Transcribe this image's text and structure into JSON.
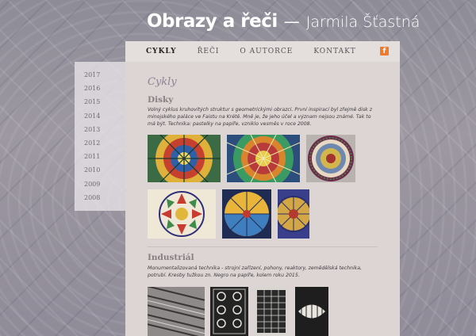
{
  "header": {
    "site_title": "Obrazy a řeči",
    "separator": "—",
    "author": "Jarmila Šťastná"
  },
  "nav": {
    "items": [
      "CYKLY",
      "ŘEČI",
      "O AUTORCE",
      "KONTAKT"
    ],
    "social_icon": "facebook-icon"
  },
  "sidebar": {
    "years": [
      "2017",
      "2016",
      "2015",
      "2014",
      "2013",
      "2012",
      "2011",
      "2010",
      "2009",
      "2008"
    ]
  },
  "main": {
    "page_title": "Cykly",
    "sections": [
      {
        "title": "Disky",
        "description": "Volný cyklus kruhovitých struktur s geometrickými obrazci. První inspirací byl zřejmě disk z minojského paláce ve Faistu na Krétě. Mně je, že jeho účel a význam nejsou známé. Tak to má být. Technika: pastelky na papíře, vzniklo vesměs v roce 2008."
      },
      {
        "title": "Industriál",
        "description": "Monumentalizovaná technika - strojní zařízení, pohony, reaktory, zemědělská technika, potrubí. Kresby tužkou zn. Negro na papíře, kolem roku 2015."
      }
    ]
  },
  "colors": {
    "nav_bg": "#e4dedd",
    "content_bg": "#dcd5d4",
    "accent_title": "#8e8494",
    "facebook": "#f07a2a"
  }
}
